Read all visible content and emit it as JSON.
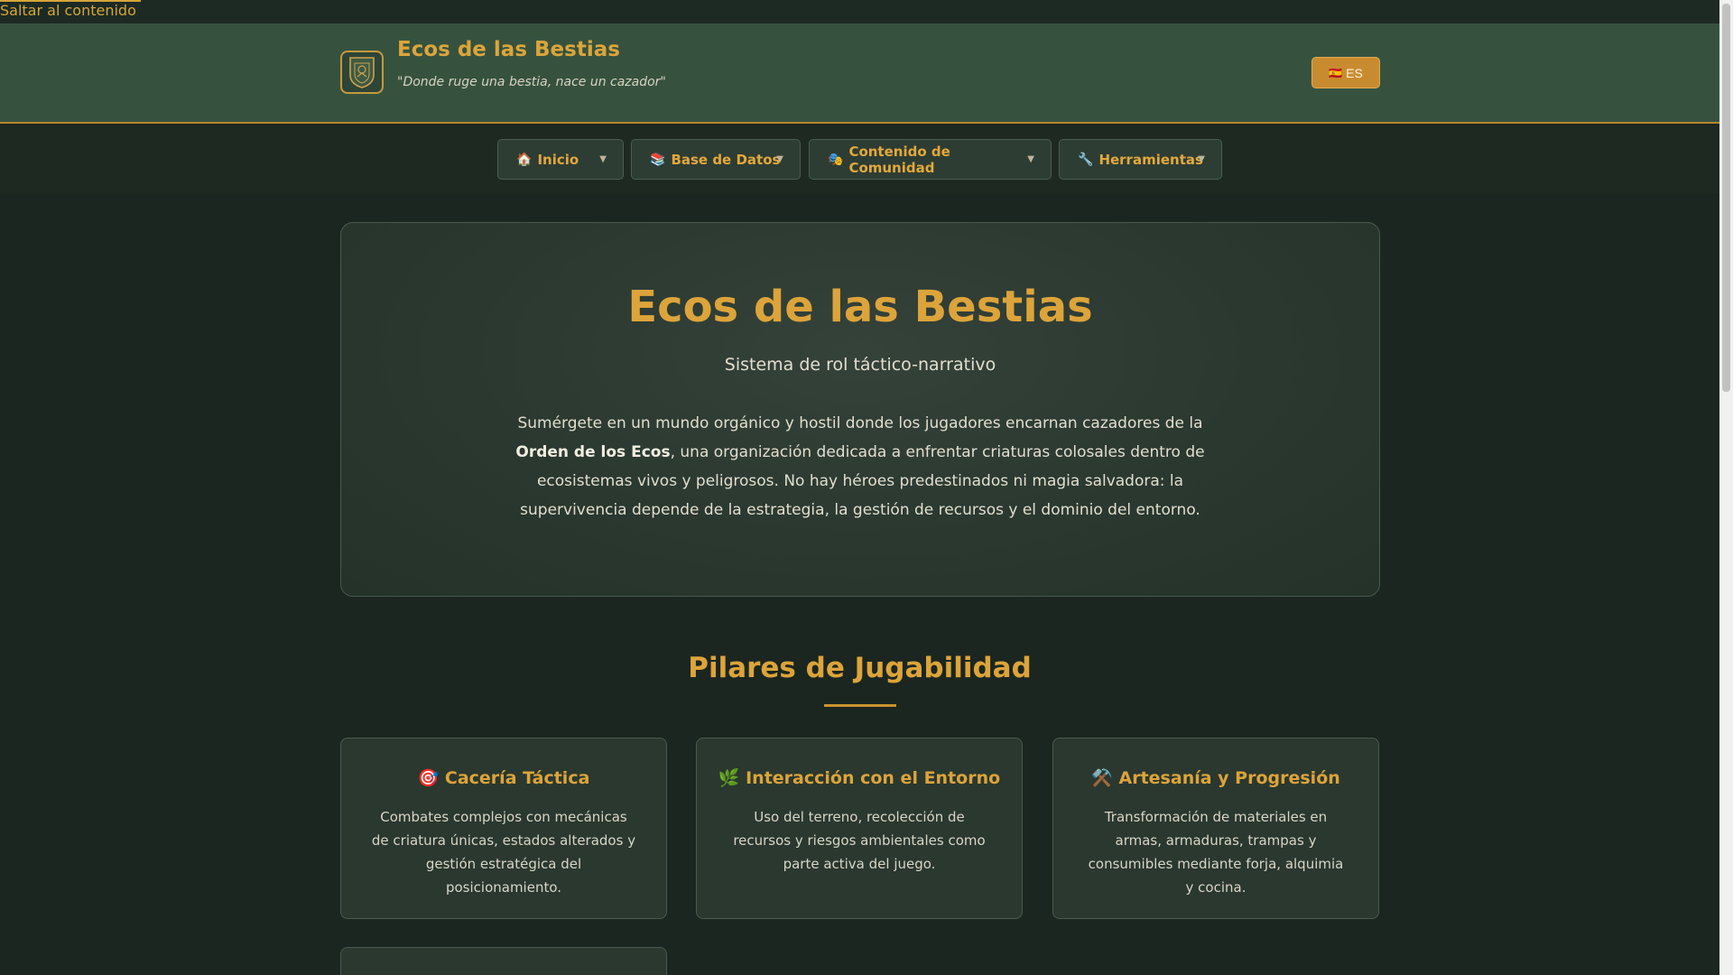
{
  "skip_link": "Saltar al contenido",
  "header": {
    "title": "Ecos de las Bestias",
    "tagline": "\"Donde ruge una bestia, nace un cazador\"",
    "lang_flag": "🇪🇸",
    "lang_label": "ES"
  },
  "nav": {
    "items": [
      {
        "icon": "🏠",
        "label": "Inicio"
      },
      {
        "icon": "📚",
        "label": "Base de Datos"
      },
      {
        "icon": "🎭",
        "label": "Contenido de Comunidad"
      },
      {
        "icon": "🔧",
        "label": "Herramientas"
      }
    ],
    "caret": "▼"
  },
  "hero": {
    "title": "Ecos de las Bestias",
    "subtitle": "Sistema de rol táctico-narrativo",
    "desc_pre": "Sumérgete en un mundo orgánico y hostil donde los jugadores encarnan cazadores de la ",
    "desc_bold": "Orden de los Ecos",
    "desc_post": ", una organización dedicada a enfrentar criaturas colosales dentro de ecosistemas vivos y peligrosos. No hay héroes predestinados ni magia salvadora: la supervivencia depende de la estrategia, la gestión de recursos y el dominio del entorno."
  },
  "pillars": {
    "title": "Pilares de Jugabilidad",
    "cards": [
      {
        "icon": "🎯",
        "title": "Cacería Táctica",
        "desc": "Combates complejos con mecánicas de criatura únicas, estados alterados y gestión estratégica del posicionamiento."
      },
      {
        "icon": "🌿",
        "title": "Interacción con el Entorno",
        "desc": "Uso del terreno, recolección de recursos y riesgos ambientales como parte activa del juego."
      },
      {
        "icon": "⚒️",
        "title": "Artesanía y Progresión",
        "desc": "Transformación de materiales en armas, armaduras, trampas y consumibles mediante forja, alquimia y cocina."
      }
    ]
  },
  "colors": {
    "accent": "#dca43a",
    "header_bg": "#36523f",
    "page_bg": "#1b2620"
  }
}
